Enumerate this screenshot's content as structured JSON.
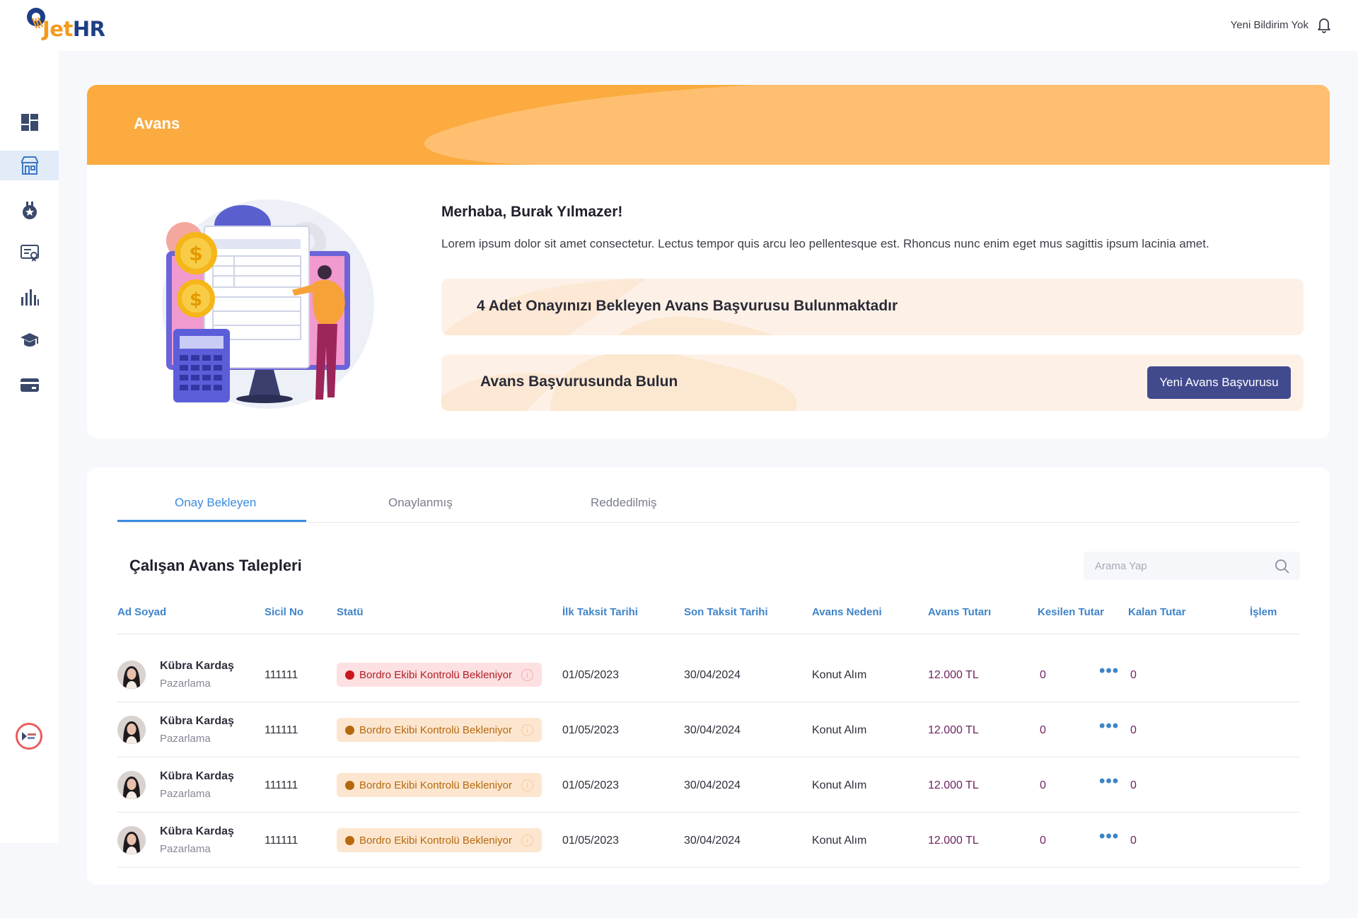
{
  "brand": {
    "jet": "Jet",
    "hr": "HR"
  },
  "header": {
    "notifications": "Yeni Bildirim Yok",
    "bell_icon": "bell-icon"
  },
  "sidebar": {
    "items": [
      {
        "icon": "dashboard-icon"
      },
      {
        "icon": "store-icon",
        "active": true
      },
      {
        "icon": "medal-icon"
      },
      {
        "icon": "certificate-icon"
      },
      {
        "icon": "chart-icon"
      },
      {
        "icon": "graduation-icon"
      },
      {
        "icon": "credit-card-icon"
      }
    ]
  },
  "hero": {
    "title": "Avans",
    "greeting": "Merhaba, Burak Yılmazer!",
    "description": "Lorem ipsum dolor sit amet consectetur. Lectus tempor quis arcu leo pellentesque est. Rhoncus nunc enim eget mus sagittis ipsum lacinia amet.",
    "pending_notice": "4 Adet Onayınızı Bekleyen Avans Başvurusu Bulunmaktadır",
    "apply_prompt": "Avans Başvurusunda Bulun",
    "apply_button": "Yeni Avans Başvurusu"
  },
  "tabs": [
    {
      "label": "Onay Bekleyen",
      "active": true
    },
    {
      "label": "Onaylanmış"
    },
    {
      "label": "Reddedilmiş"
    }
  ],
  "list": {
    "title": "Çalışan Avans Talepleri",
    "search_placeholder": "Arama Yap",
    "columns": [
      "Ad Soyad",
      "Sicil No",
      "Statü",
      "İlk Taksit Tarihi",
      "Son Taksit Tarihi",
      "Avans Nedeni",
      "Avans Tutarı",
      "Kesilen Tutar",
      "Kalan Tutar",
      "İşlem"
    ],
    "rows": [
      {
        "name": "Kübra Kardaş",
        "dept": "Pazarlama",
        "sicil": "111111",
        "status": "Bordro Ekibi Kontrolü Bekleniyor",
        "status_color": "#c7161f",
        "first": "01/05/2023",
        "last": "30/04/2024",
        "reason": "Konut Alım",
        "amount": "12.000 TL",
        "deducted": "0",
        "remaining": "0",
        "action": "•••"
      },
      {
        "name": "Kübra Kardaş",
        "dept": "Pazarlama",
        "sicil": "111111",
        "status": "Bordro Ekibi Kontrolü Bekleniyor",
        "status_color": "#b5680d",
        "first": "01/05/2023",
        "last": "30/04/2024",
        "reason": "Konut Alım",
        "amount": "12.000 TL",
        "deducted": "0",
        "remaining": "0",
        "action": "•••"
      },
      {
        "name": "Kübra Kardaş",
        "dept": "Pazarlama",
        "sicil": "111111",
        "status": "Bordro Ekibi Kontrolü Bekleniyor",
        "status_color": "#b5680d",
        "first": "01/05/2023",
        "last": "30/04/2024",
        "reason": "Konut Alım",
        "amount": "12.000 TL",
        "deducted": "0",
        "remaining": "0",
        "action": "•••"
      },
      {
        "name": "Kübra Kardaş",
        "dept": "Pazarlama",
        "sicil": "111111",
        "status": "Bordro Ekibi Kontrolü Bekleniyor",
        "status_color": "#b5680d",
        "first": "01/05/2023",
        "last": "30/04/2024",
        "reason": "Konut Alım",
        "amount": "12.000 TL",
        "deducted": "0",
        "remaining": "0",
        "action": "•••"
      }
    ]
  },
  "colors": {
    "accent": "#3a8be0",
    "banner": "#fbab3f",
    "button": "#424a8e",
    "money": "#6e2361"
  }
}
